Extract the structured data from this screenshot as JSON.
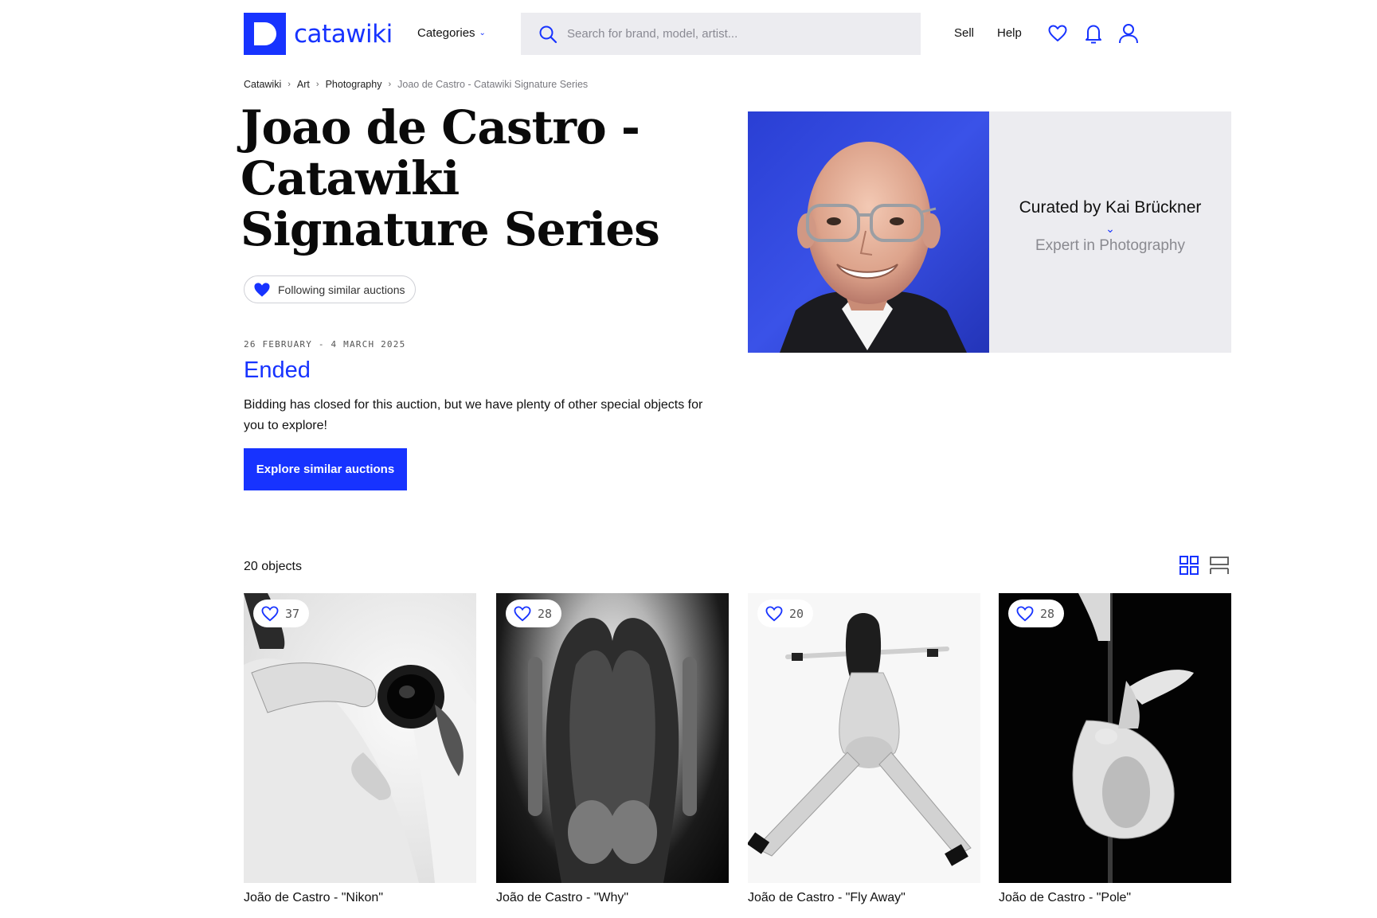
{
  "header": {
    "logo_text": "catawiki",
    "categories_label": "Categories",
    "search_placeholder": "Search for brand, model, artist...",
    "sell_label": "Sell",
    "help_label": "Help",
    "brand_color": "#1733ff"
  },
  "breadcrumb": {
    "items": [
      "Catawiki",
      "Art",
      "Photography"
    ],
    "current": "Joao de Castro - Catawiki Signature Series"
  },
  "auction": {
    "title": "Joao de Castro - Catawiki Signature Series",
    "follow_label": "Following similar auctions",
    "dates": "26 FEBRUARY - 4 MARCH 2025",
    "status": "Ended",
    "description": "Bidding has closed for this auction, but we have plenty of other special objects for you to explore!",
    "explore_label": "Explore similar auctions"
  },
  "curator": {
    "name": "Curated by Kai Brückner",
    "role": "Expert in Photography"
  },
  "objects": {
    "count_label": "20 objects",
    "lots": [
      {
        "title": "João de Castro - \"Nikon\"",
        "favorites": "37"
      },
      {
        "title": "João de Castro - \"Why\"",
        "favorites": "28"
      },
      {
        "title": "João de Castro - \"Fly Away\"",
        "favorites": "20"
      },
      {
        "title": "João de Castro - \"Pole\"",
        "favorites": "28"
      }
    ]
  }
}
